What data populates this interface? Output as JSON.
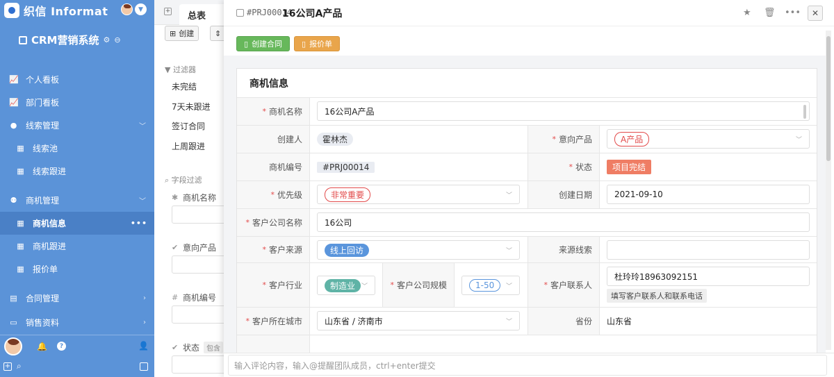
{
  "brand": {
    "name": "织信 Informat"
  },
  "app": {
    "title": "CRM营销系统"
  },
  "sidebar": {
    "items": [
      {
        "label": "个人看板"
      },
      {
        "label": "部门看板"
      },
      {
        "label": "线索管理"
      },
      {
        "label": "线索池"
      },
      {
        "label": "线索跟进"
      },
      {
        "label": "商机管理"
      },
      {
        "label": "商机信息"
      },
      {
        "label": "商机跟进"
      },
      {
        "label": "报价单"
      },
      {
        "label": "合同管理"
      },
      {
        "label": "销售资料"
      }
    ],
    "active_more": "•••"
  },
  "middle": {
    "tab": "总表",
    "create_label": "创建",
    "filter_title": "过滤器",
    "filters": [
      "未完结",
      "7天未跟进",
      "签订合同",
      "上周跟进"
    ],
    "field_filter_title": "字段过滤",
    "fields": [
      {
        "label": "商机名称"
      },
      {
        "label": "意向产品"
      },
      {
        "label": "商机编号"
      },
      {
        "label": "状态",
        "tag": "包含"
      }
    ]
  },
  "detail": {
    "code": "#PRJ00014",
    "title": "16公司A产品",
    "actions": {
      "create_contract": "创建合同",
      "quote": "报价单"
    },
    "section_title": "商机信息",
    "fields": {
      "opp_name_label": "商机名称",
      "opp_name": "16公司A产品",
      "creator_label": "创建人",
      "creator": "霍林杰",
      "product_label": "意向产品",
      "product": "A产品",
      "code_label": "商机编号",
      "code": "#PRJ00014",
      "status_label": "状态",
      "status": "项目完结",
      "priority_label": "优先级",
      "priority": "非常重要",
      "created_label": "创建日期",
      "created": "2021-09-10",
      "company_label": "客户公司名称",
      "company": "16公司",
      "source_label": "客户来源",
      "source": "线上回访",
      "lead_label": "来源线索",
      "lead": "",
      "industry_label": "客户行业",
      "industry": "制造业",
      "size_label": "客户公司规模",
      "size": "1-50",
      "contact_label": "客户联系人",
      "contact": "杜玲玲18963092151",
      "contact_hint": "填写客户联系人和联系电话",
      "city_label": "客户所在城市",
      "city": "山东省 / 济南市",
      "province_label": "省份",
      "province": "山东省"
    },
    "comment_placeholder": "输入评论内容，输入@提醒团队成员，ctrl+enter提交"
  }
}
